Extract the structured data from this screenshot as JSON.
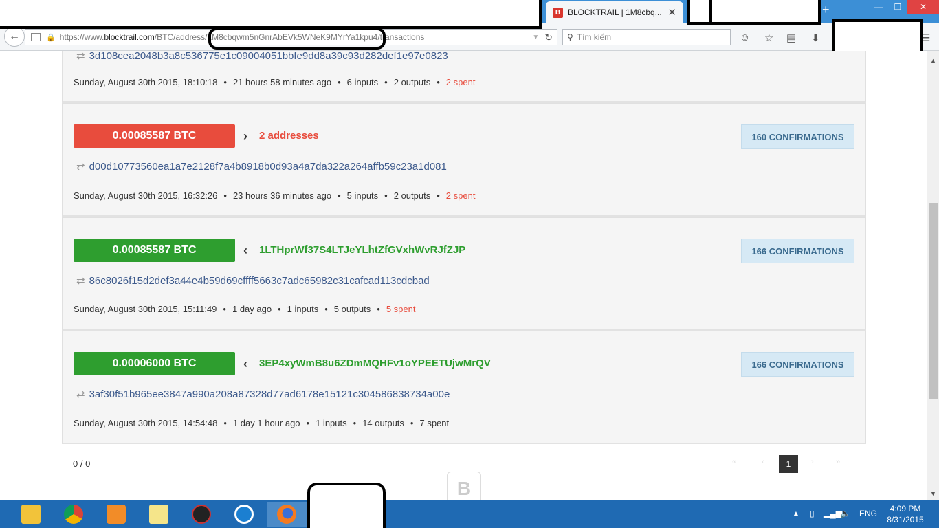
{
  "browser": {
    "tab_title": "BLOCKTRAIL | 1M8cbq...",
    "tab_favicon": "B",
    "new_tab_label": "+",
    "url_prefix": "https://www.",
    "url_domain": "blocktrail.com",
    "url_path": "/BTC/address/1M8cbqwm5nGnrAbEVk5WNeK9MYrYa1kpu4/transactions",
    "search_placeholder": "Tìm kiếm"
  },
  "top_partial": {
    "hash": "3d108cea2048b3a8c536775e1c09004051bbfe9dd8a39c93d282def1e97e0823",
    "date": "Sunday, August 30th 2015, 18:10:18",
    "ago": "21 hours 58 minutes ago",
    "inputs": "6 inputs",
    "outputs": "2 outputs",
    "spent": "2 spent"
  },
  "transactions": [
    {
      "amount": "0.00085587 BTC",
      "direction": "›",
      "address": "2 addresses",
      "confirmations": "160 CONFIRMATIONS",
      "hash": "d00d10773560ea1a7e2128f7a4b8918b0d93a4a7da322a264affb59c23a1d081",
      "date": "Sunday, August 30th 2015, 16:32:26",
      "ago": "23 hours 36 minutes ago",
      "inputs": "5 inputs",
      "outputs": "2 outputs",
      "spent": "2 spent"
    },
    {
      "amount": "0.00085587 BTC",
      "direction": "‹",
      "address": "1LTHprWf37S4LTJeYLhtZfGVxhWvRJfZJP",
      "confirmations": "166 CONFIRMATIONS",
      "hash": "86c8026f15d2def3a44e4b59d69cffff5663c7adc65982c31cafcad113cdcbad",
      "date": "Sunday, August 30th 2015, 15:11:49",
      "ago": "1 day ago",
      "inputs": "1 inputs",
      "outputs": "5 outputs",
      "spent": "5 spent"
    },
    {
      "amount": "0.00006000 BTC",
      "direction": "‹",
      "address": "3EP4xyWmB8u6ZDmMQHFv1oYPEETUjwMrQV",
      "confirmations": "166 CONFIRMATIONS",
      "hash": "3af30f51b965ee3847a990a208a87328d77ad6178e15121c304586838734a00e",
      "date": "Sunday, August 30th 2015, 14:54:48",
      "ago": "1 day 1 hour ago",
      "inputs": "1 inputs",
      "outputs": "14 outputs",
      "spent": "7 spent"
    }
  ],
  "footer": {
    "count": "0 / 0",
    "current_page": "1",
    "logo": "B"
  },
  "taskbar": {
    "language": "ENG",
    "time": "4:09 PM",
    "date": "8/31/2015"
  },
  "colors": {
    "outgoing": "#e84c3d",
    "incoming": "#2e9e2f",
    "confirmations_bg": "#d6e9f5"
  }
}
